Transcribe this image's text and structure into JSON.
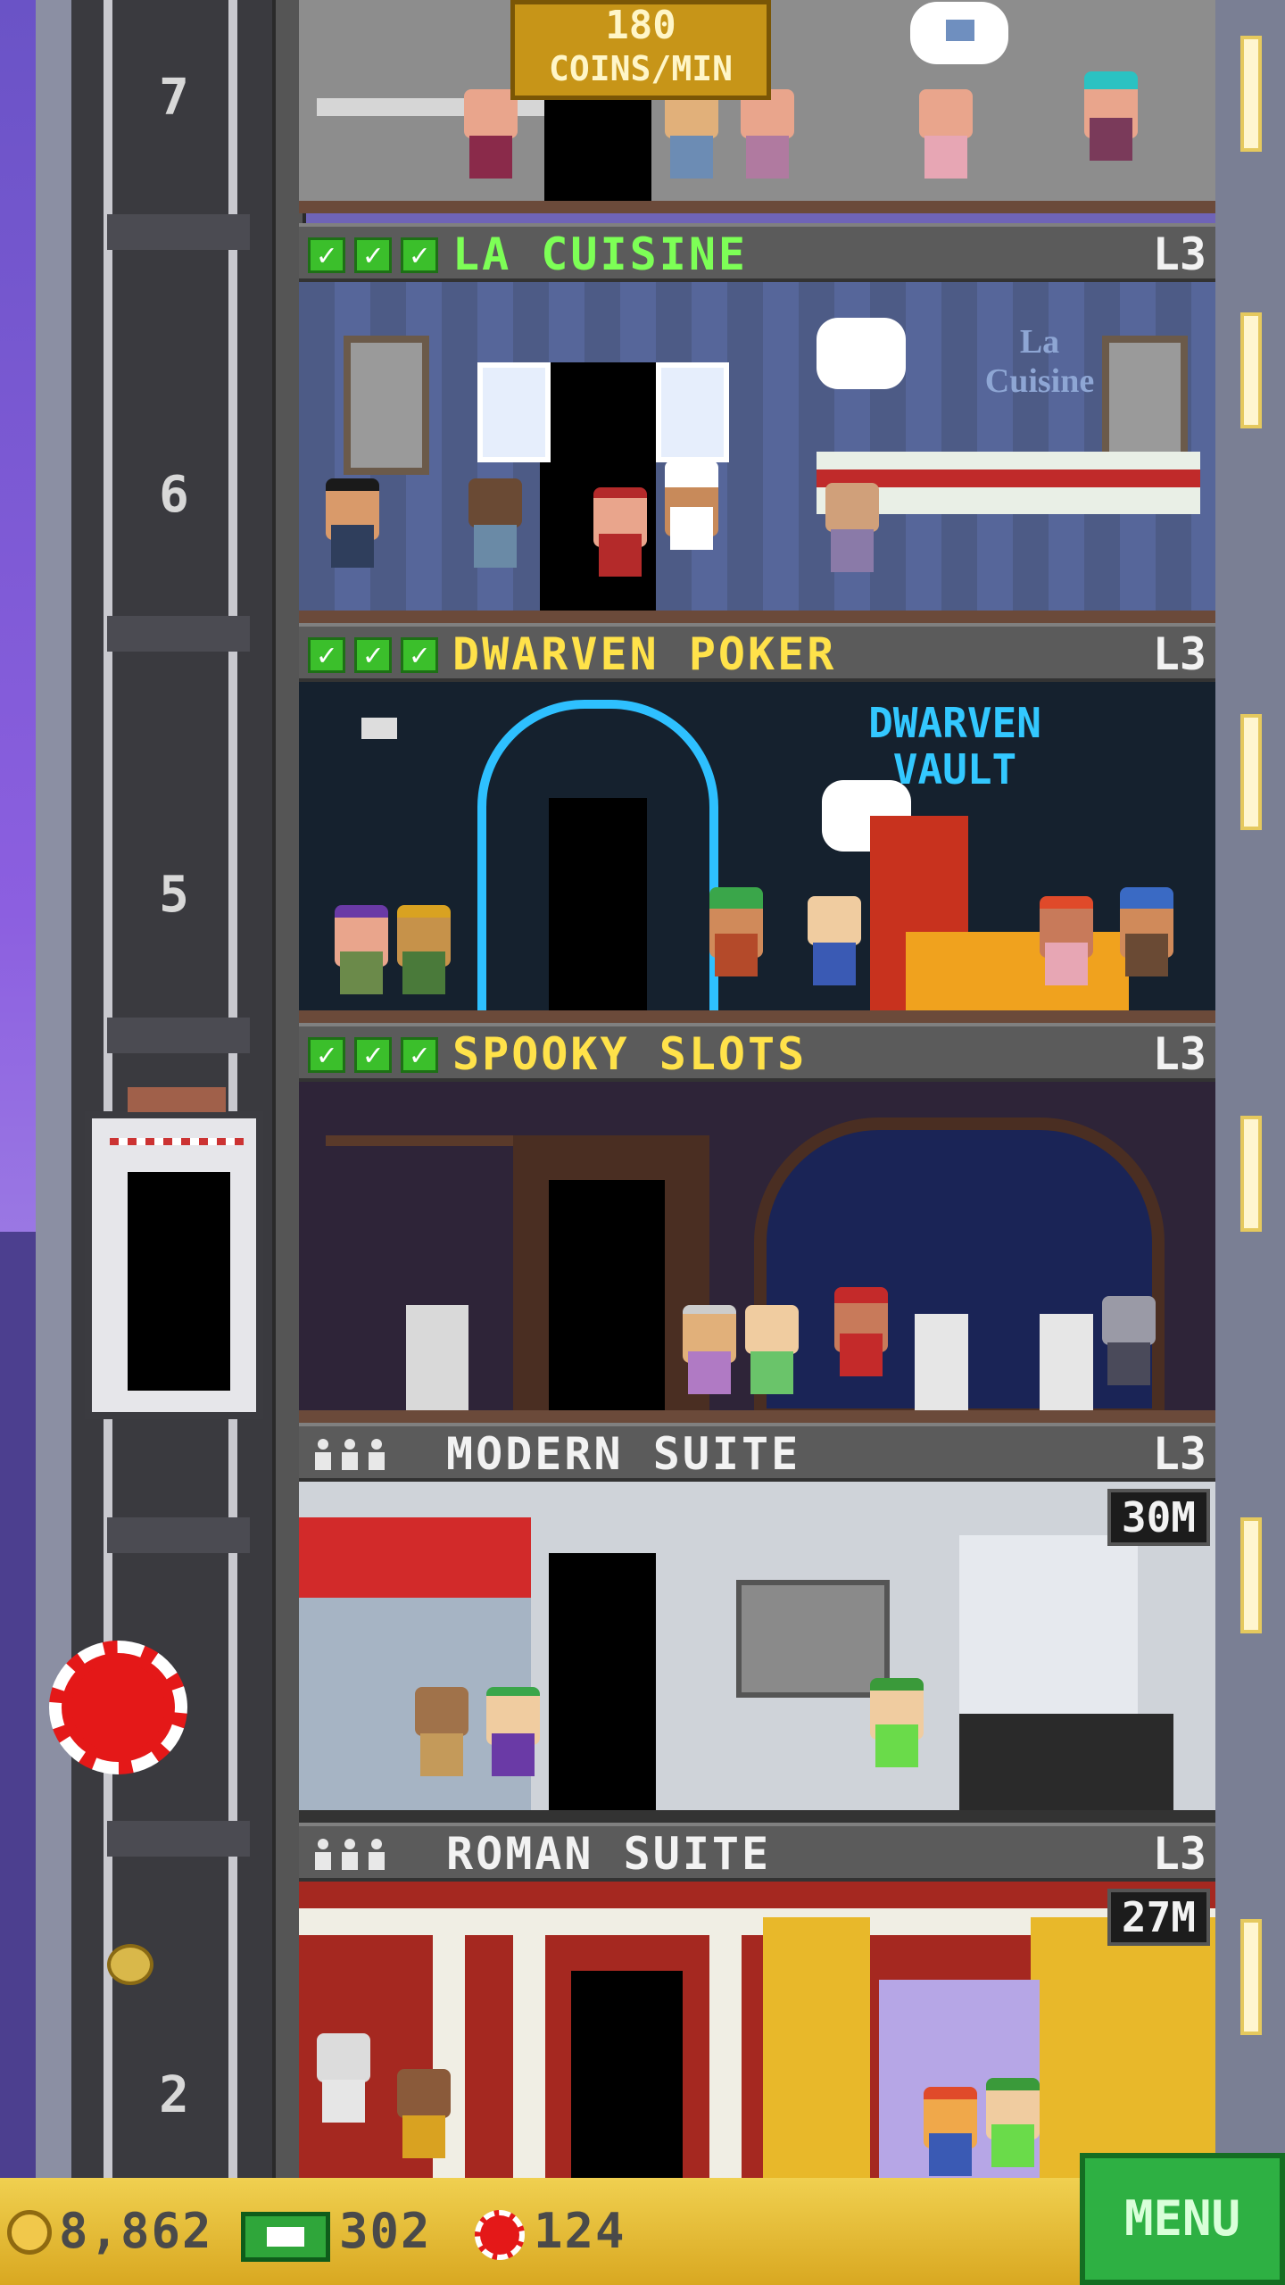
{
  "top_badge": {
    "value": "180",
    "unit": "COINS/MIN"
  },
  "floor_numbers": [
    "7",
    "6",
    "5",
    "2"
  ],
  "floors": [
    {
      "name": "LA CUISINE",
      "level": "L3",
      "checks": 3,
      "name_color": "#7dff56",
      "room_bg": "#4d5b86",
      "sign": [
        "La",
        "Cuisine"
      ]
    },
    {
      "name": "DWARVEN POKER",
      "level": "L3",
      "checks": 3,
      "name_color": "#ffe24a",
      "room_bg": "#15212e",
      "sign": [
        "DWARVEN",
        "VAULT"
      ]
    },
    {
      "name": "SPOOKY SLOTS",
      "level": "L3",
      "checks": 3,
      "name_color": "#ffe24a",
      "room_bg": "#2e2438"
    },
    {
      "name": "MODERN SUITE",
      "level": "L3",
      "residents": 3,
      "timer": "30M",
      "room_bg": "#cfd3d9"
    },
    {
      "name": "ROMAN SUITE",
      "level": "L3",
      "residents": 3,
      "timer": "27M",
      "room_bg": "#a52820"
    }
  ],
  "hud": {
    "coins": "8,862",
    "bux": "302",
    "chips": "124",
    "menu_label": "MENU"
  }
}
